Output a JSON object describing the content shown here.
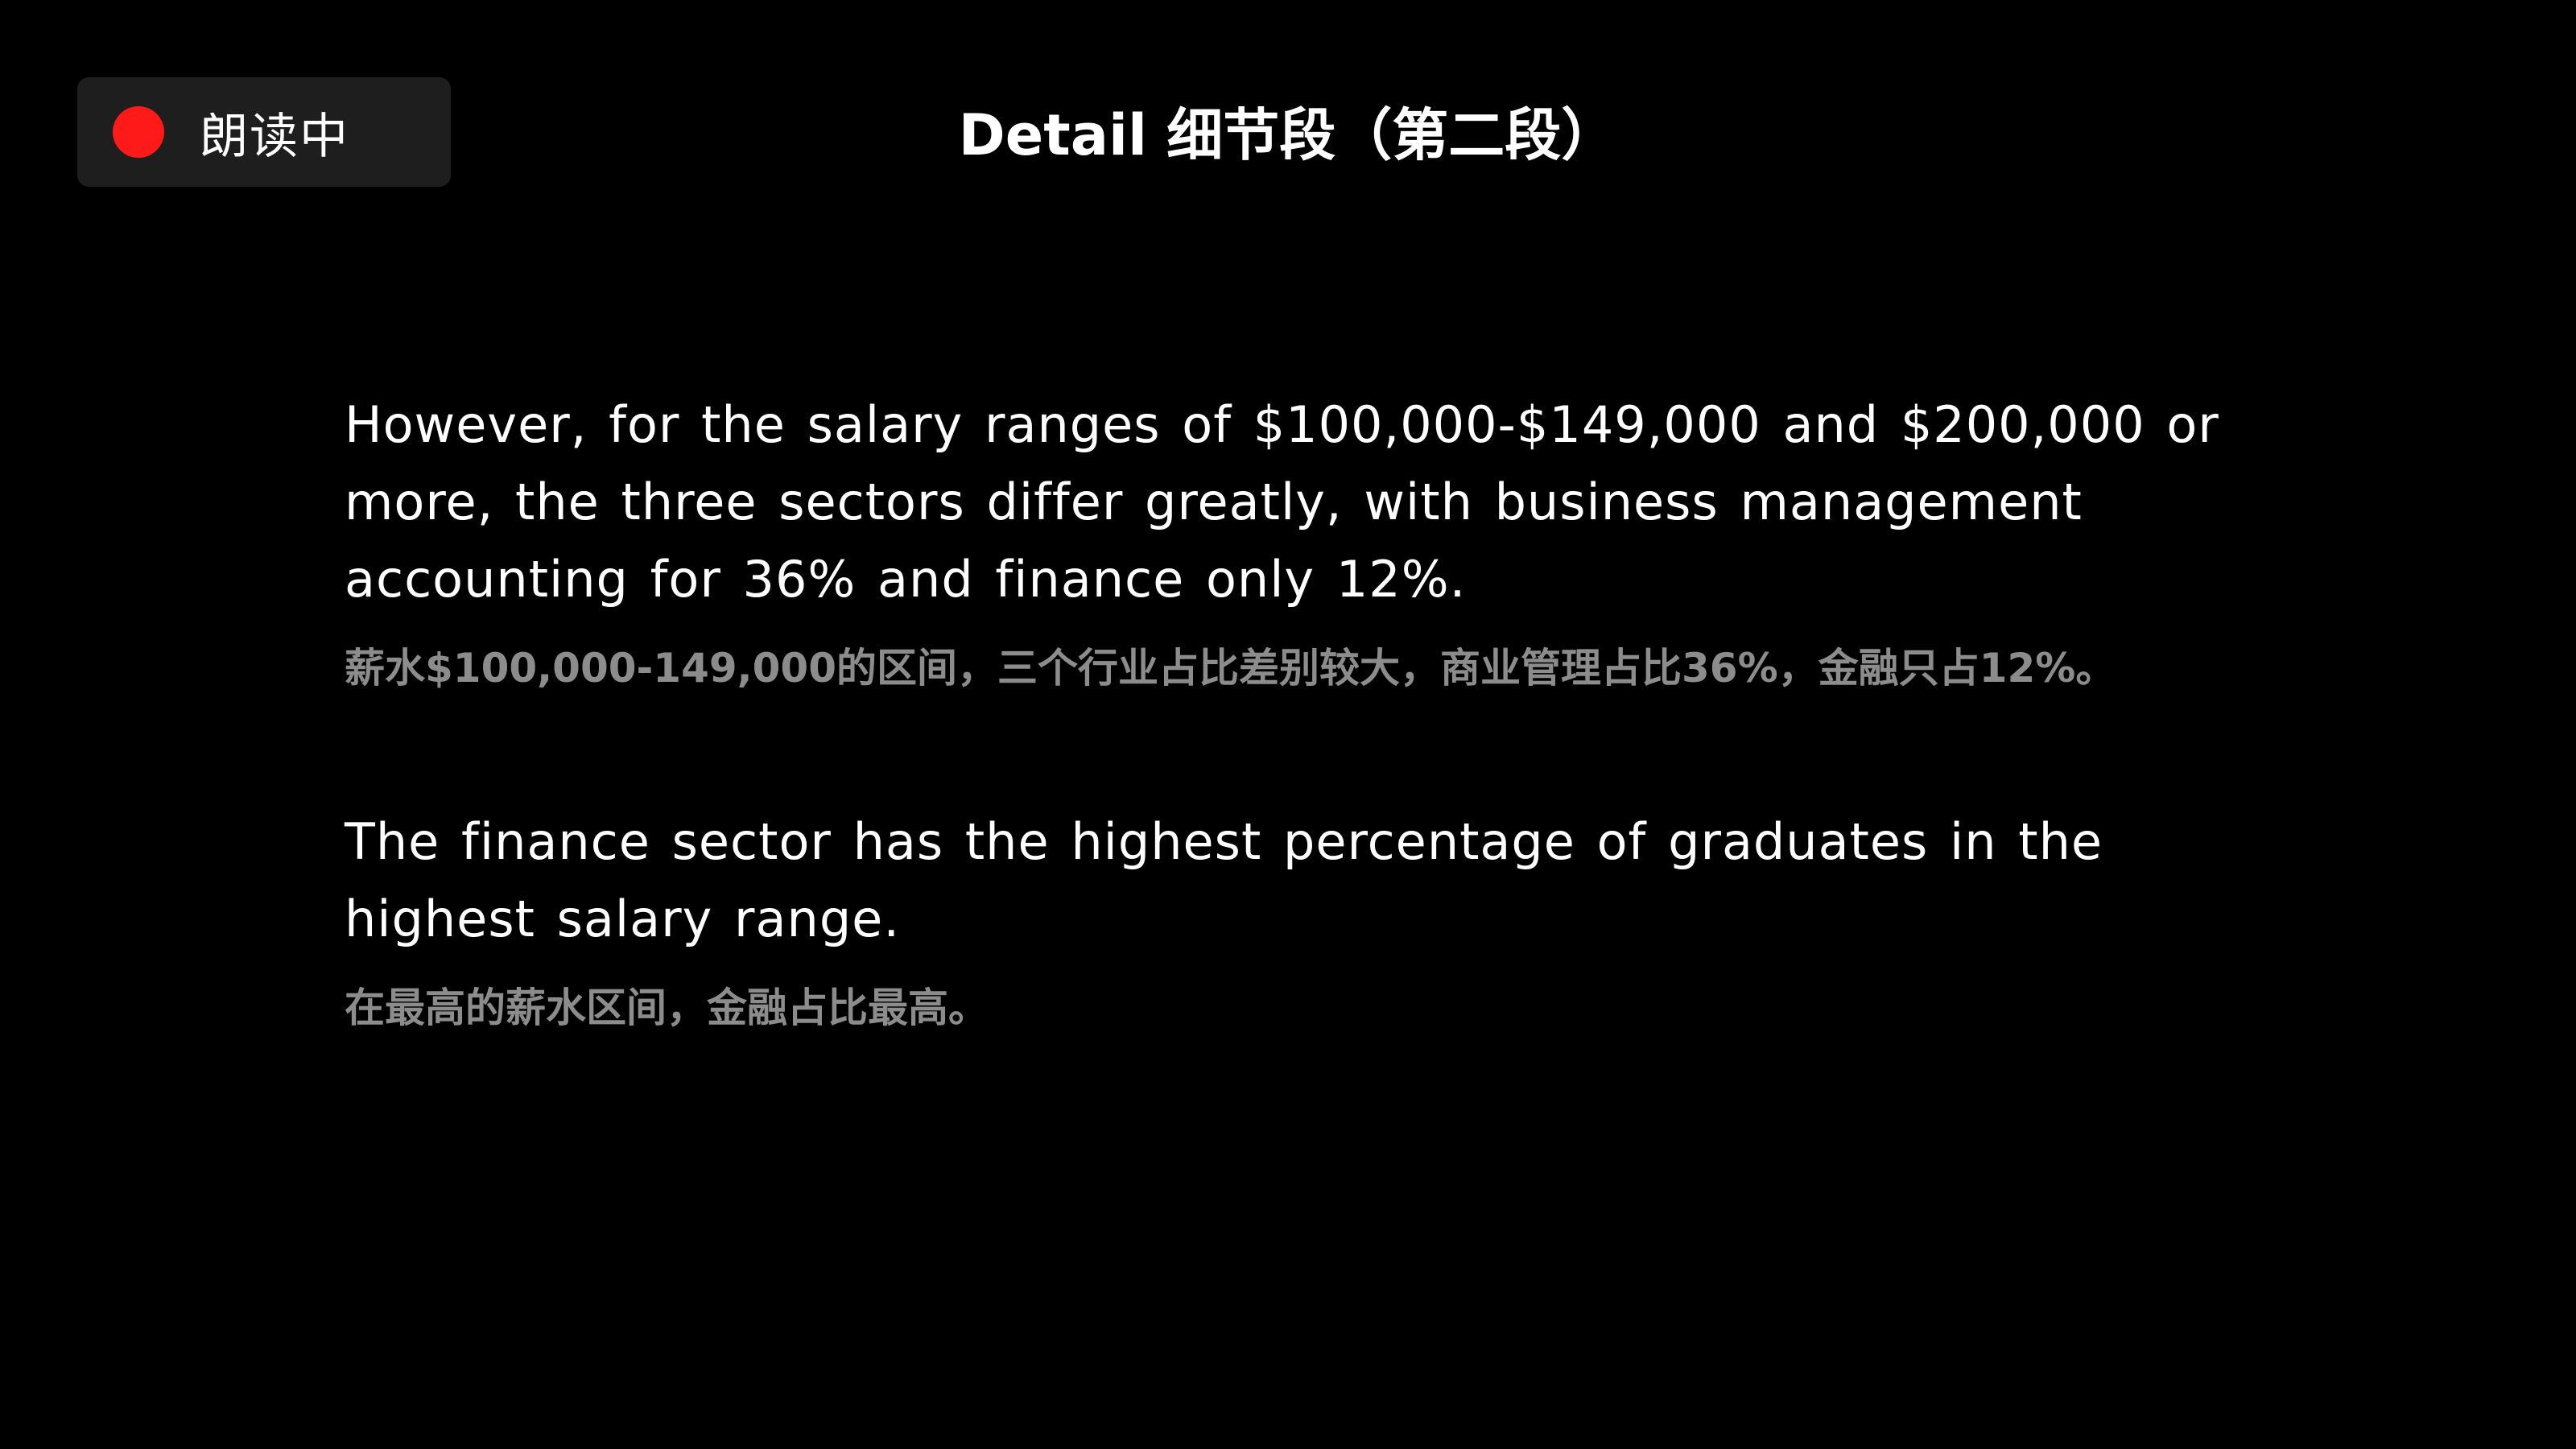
{
  "status": {
    "label": "朗读中",
    "dot_color": "#ff1a1a",
    "icon": "record-dot-icon"
  },
  "header": {
    "title": "Detail 细节段（第二段）"
  },
  "paragraphs": [
    {
      "english": "However, for the salary ranges of $100,000-$149,000 and $200,000 or more, the three sectors differ greatly, with business management accounting for 36% and finance only 12%.",
      "chinese": "薪水$100,000-149,000的区间，三个行业占比差别较大，商业管理占比36%，金融只占12%。"
    },
    {
      "english": "The finance sector has the highest percentage of graduates in the highest salary range.",
      "chinese": "在最高的薪水区间，金融占比最高。"
    }
  ],
  "colors": {
    "background": "#000000",
    "primary_text": "#ffffff",
    "translation_text": "#8c8c8c",
    "pill_background": "#1e1e1e"
  }
}
